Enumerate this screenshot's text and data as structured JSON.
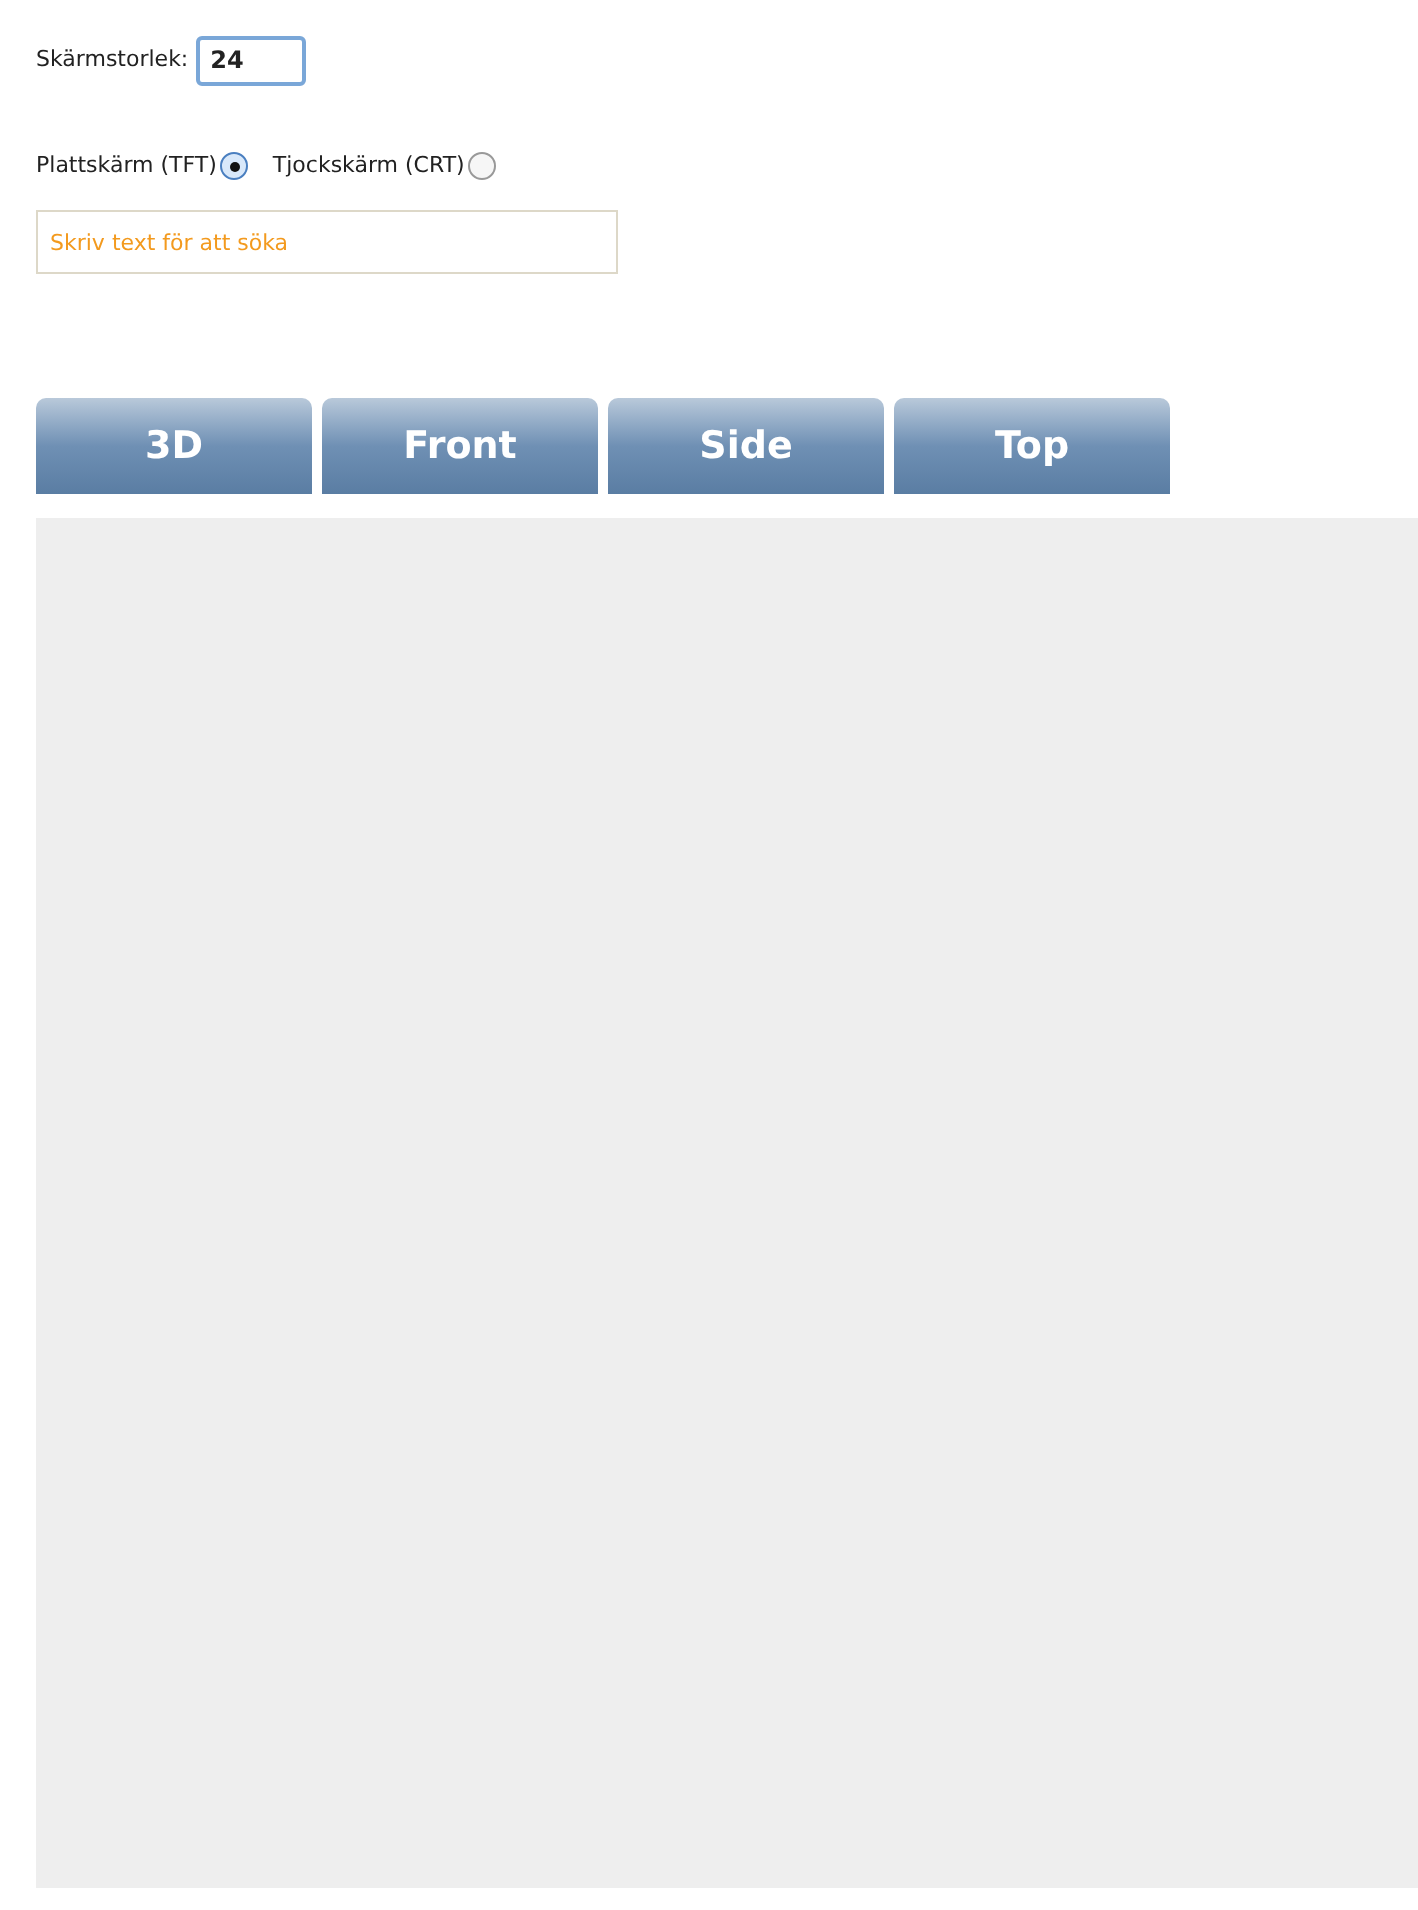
{
  "screen_size": {
    "label": "Skärmstorlek:",
    "value": "24"
  },
  "screen_types": [
    {
      "label": "Plattskärm (TFT)",
      "selected": true
    },
    {
      "label": "Tjockskärm (CRT)",
      "selected": false
    }
  ],
  "search": {
    "placeholder": "Skriv text för att söka"
  },
  "tabs": [
    {
      "label": "3D",
      "selected": false
    },
    {
      "label": "Front",
      "selected": false
    },
    {
      "label": "Side",
      "selected": false
    },
    {
      "label": "Top",
      "selected": false
    }
  ]
}
